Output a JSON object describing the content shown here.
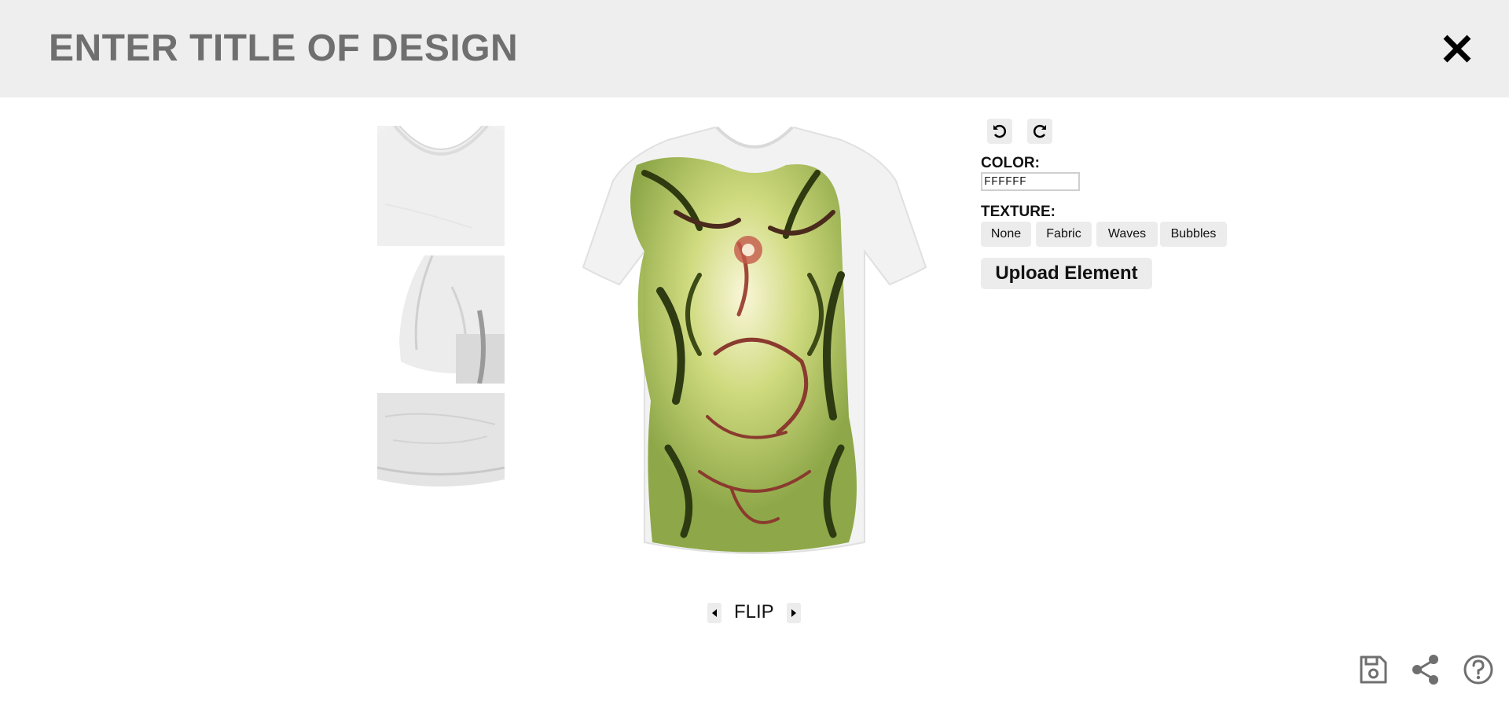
{
  "header": {
    "title": "ENTER TITLE OF DESIGN",
    "close_icon": "close-icon"
  },
  "thumbnails": [
    {
      "view": "collar"
    },
    {
      "view": "sleeve"
    },
    {
      "view": "hem"
    }
  ],
  "toolbar": {
    "undo_icon": "undo-icon",
    "redo_icon": "redo-icon"
  },
  "color": {
    "label": "COLOR:",
    "value": "FFFFFF"
  },
  "texture": {
    "label": "TEXTURE:",
    "options": [
      "None",
      "Fabric",
      "Waves",
      "Bubbles"
    ]
  },
  "upload": {
    "label": "Upload Element"
  },
  "flip": {
    "label": "FLIP"
  },
  "footer_icons": [
    "save-icon",
    "share-icon",
    "help-icon"
  ],
  "colors": {
    "header_bg": "#eeeeee",
    "title": "#6f6f6f",
    "button_bg": "#ececec",
    "design_green": "#8fae2f",
    "design_rust": "#a0483a"
  }
}
